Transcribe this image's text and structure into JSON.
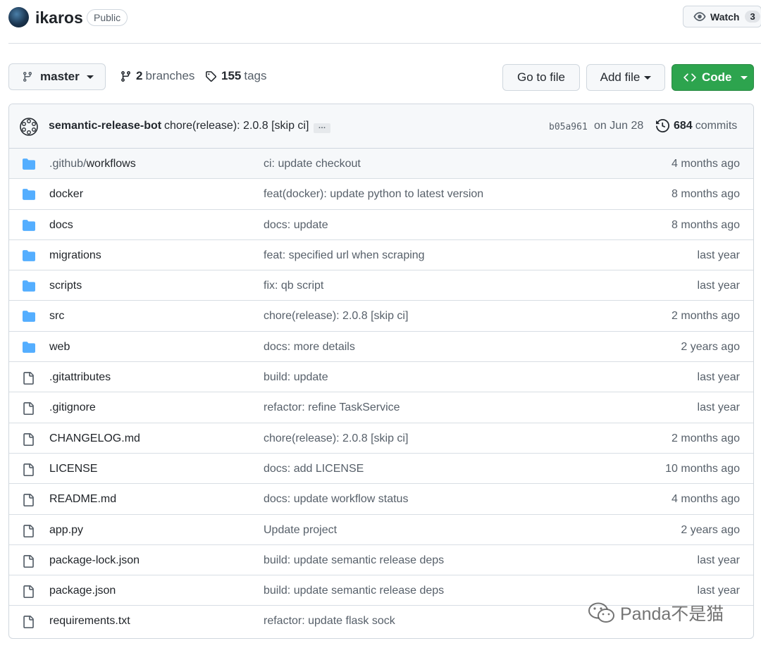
{
  "repo": {
    "name": "ikaros",
    "visibility": "Public"
  },
  "watch": {
    "label": "Watch",
    "count": "3"
  },
  "toolbar": {
    "branch": "master",
    "branches_count": "2",
    "branches_label": "branches",
    "tags_count": "155",
    "tags_label": "tags",
    "goto_file": "Go to file",
    "add_file": "Add file",
    "code": "Code"
  },
  "latest_commit": {
    "author": "semantic-release-bot",
    "message": "chore(release): 2.0.8 [skip ci]",
    "ellipsis": "…",
    "sha": "b05a961",
    "date": "on Jun 28",
    "commits_count": "684",
    "commits_label": "commits"
  },
  "files": [
    {
      "name_prefix": ".github/",
      "name": "workflows",
      "type": "dir",
      "message": "ci: update checkout",
      "age": "4 months ago"
    },
    {
      "name_prefix": "",
      "name": "docker",
      "type": "dir",
      "message": "feat(docker): update python to latest version",
      "age": "8 months ago"
    },
    {
      "name_prefix": "",
      "name": "docs",
      "type": "dir",
      "message": "docs: update",
      "age": "8 months ago"
    },
    {
      "name_prefix": "",
      "name": "migrations",
      "type": "dir",
      "message": "feat: specified url when scraping",
      "age": "last year"
    },
    {
      "name_prefix": "",
      "name": "scripts",
      "type": "dir",
      "message": "fix: qb script",
      "age": "last year"
    },
    {
      "name_prefix": "",
      "name": "src",
      "type": "dir",
      "message": "chore(release): 2.0.8 [skip ci]",
      "age": "2 months ago"
    },
    {
      "name_prefix": "",
      "name": "web",
      "type": "dir",
      "message": "docs: more details",
      "age": "2 years ago"
    },
    {
      "name_prefix": "",
      "name": ".gitattributes",
      "type": "file",
      "message": "build: update",
      "age": "last year"
    },
    {
      "name_prefix": "",
      "name": ".gitignore",
      "type": "file",
      "message": "refactor: refine TaskService",
      "age": "last year"
    },
    {
      "name_prefix": "",
      "name": "CHANGELOG.md",
      "type": "file",
      "message": "chore(release): 2.0.8 [skip ci]",
      "age": "2 months ago"
    },
    {
      "name_prefix": "",
      "name": "LICENSE",
      "type": "file",
      "message": "docs: add LICENSE",
      "age": "10 months ago"
    },
    {
      "name_prefix": "",
      "name": "README.md",
      "type": "file",
      "message": "docs: update workflow status",
      "age": "4 months ago"
    },
    {
      "name_prefix": "",
      "name": "app.py",
      "type": "file",
      "message": "Update project",
      "age": "2 years ago"
    },
    {
      "name_prefix": "",
      "name": "package-lock.json",
      "type": "file",
      "message": "build: update semantic release deps",
      "age": "last year"
    },
    {
      "name_prefix": "",
      "name": "package.json",
      "type": "file",
      "message": "build: update semantic release deps",
      "age": "last year"
    },
    {
      "name_prefix": "",
      "name": "requirements.txt",
      "type": "file",
      "message": "refactor: update flask sock",
      "age": ""
    }
  ],
  "watermark": {
    "text": "Panda不是猫"
  },
  "colors": {
    "folder": "#54aeff",
    "code_button": "#2da44e",
    "muted": "#57606a"
  }
}
